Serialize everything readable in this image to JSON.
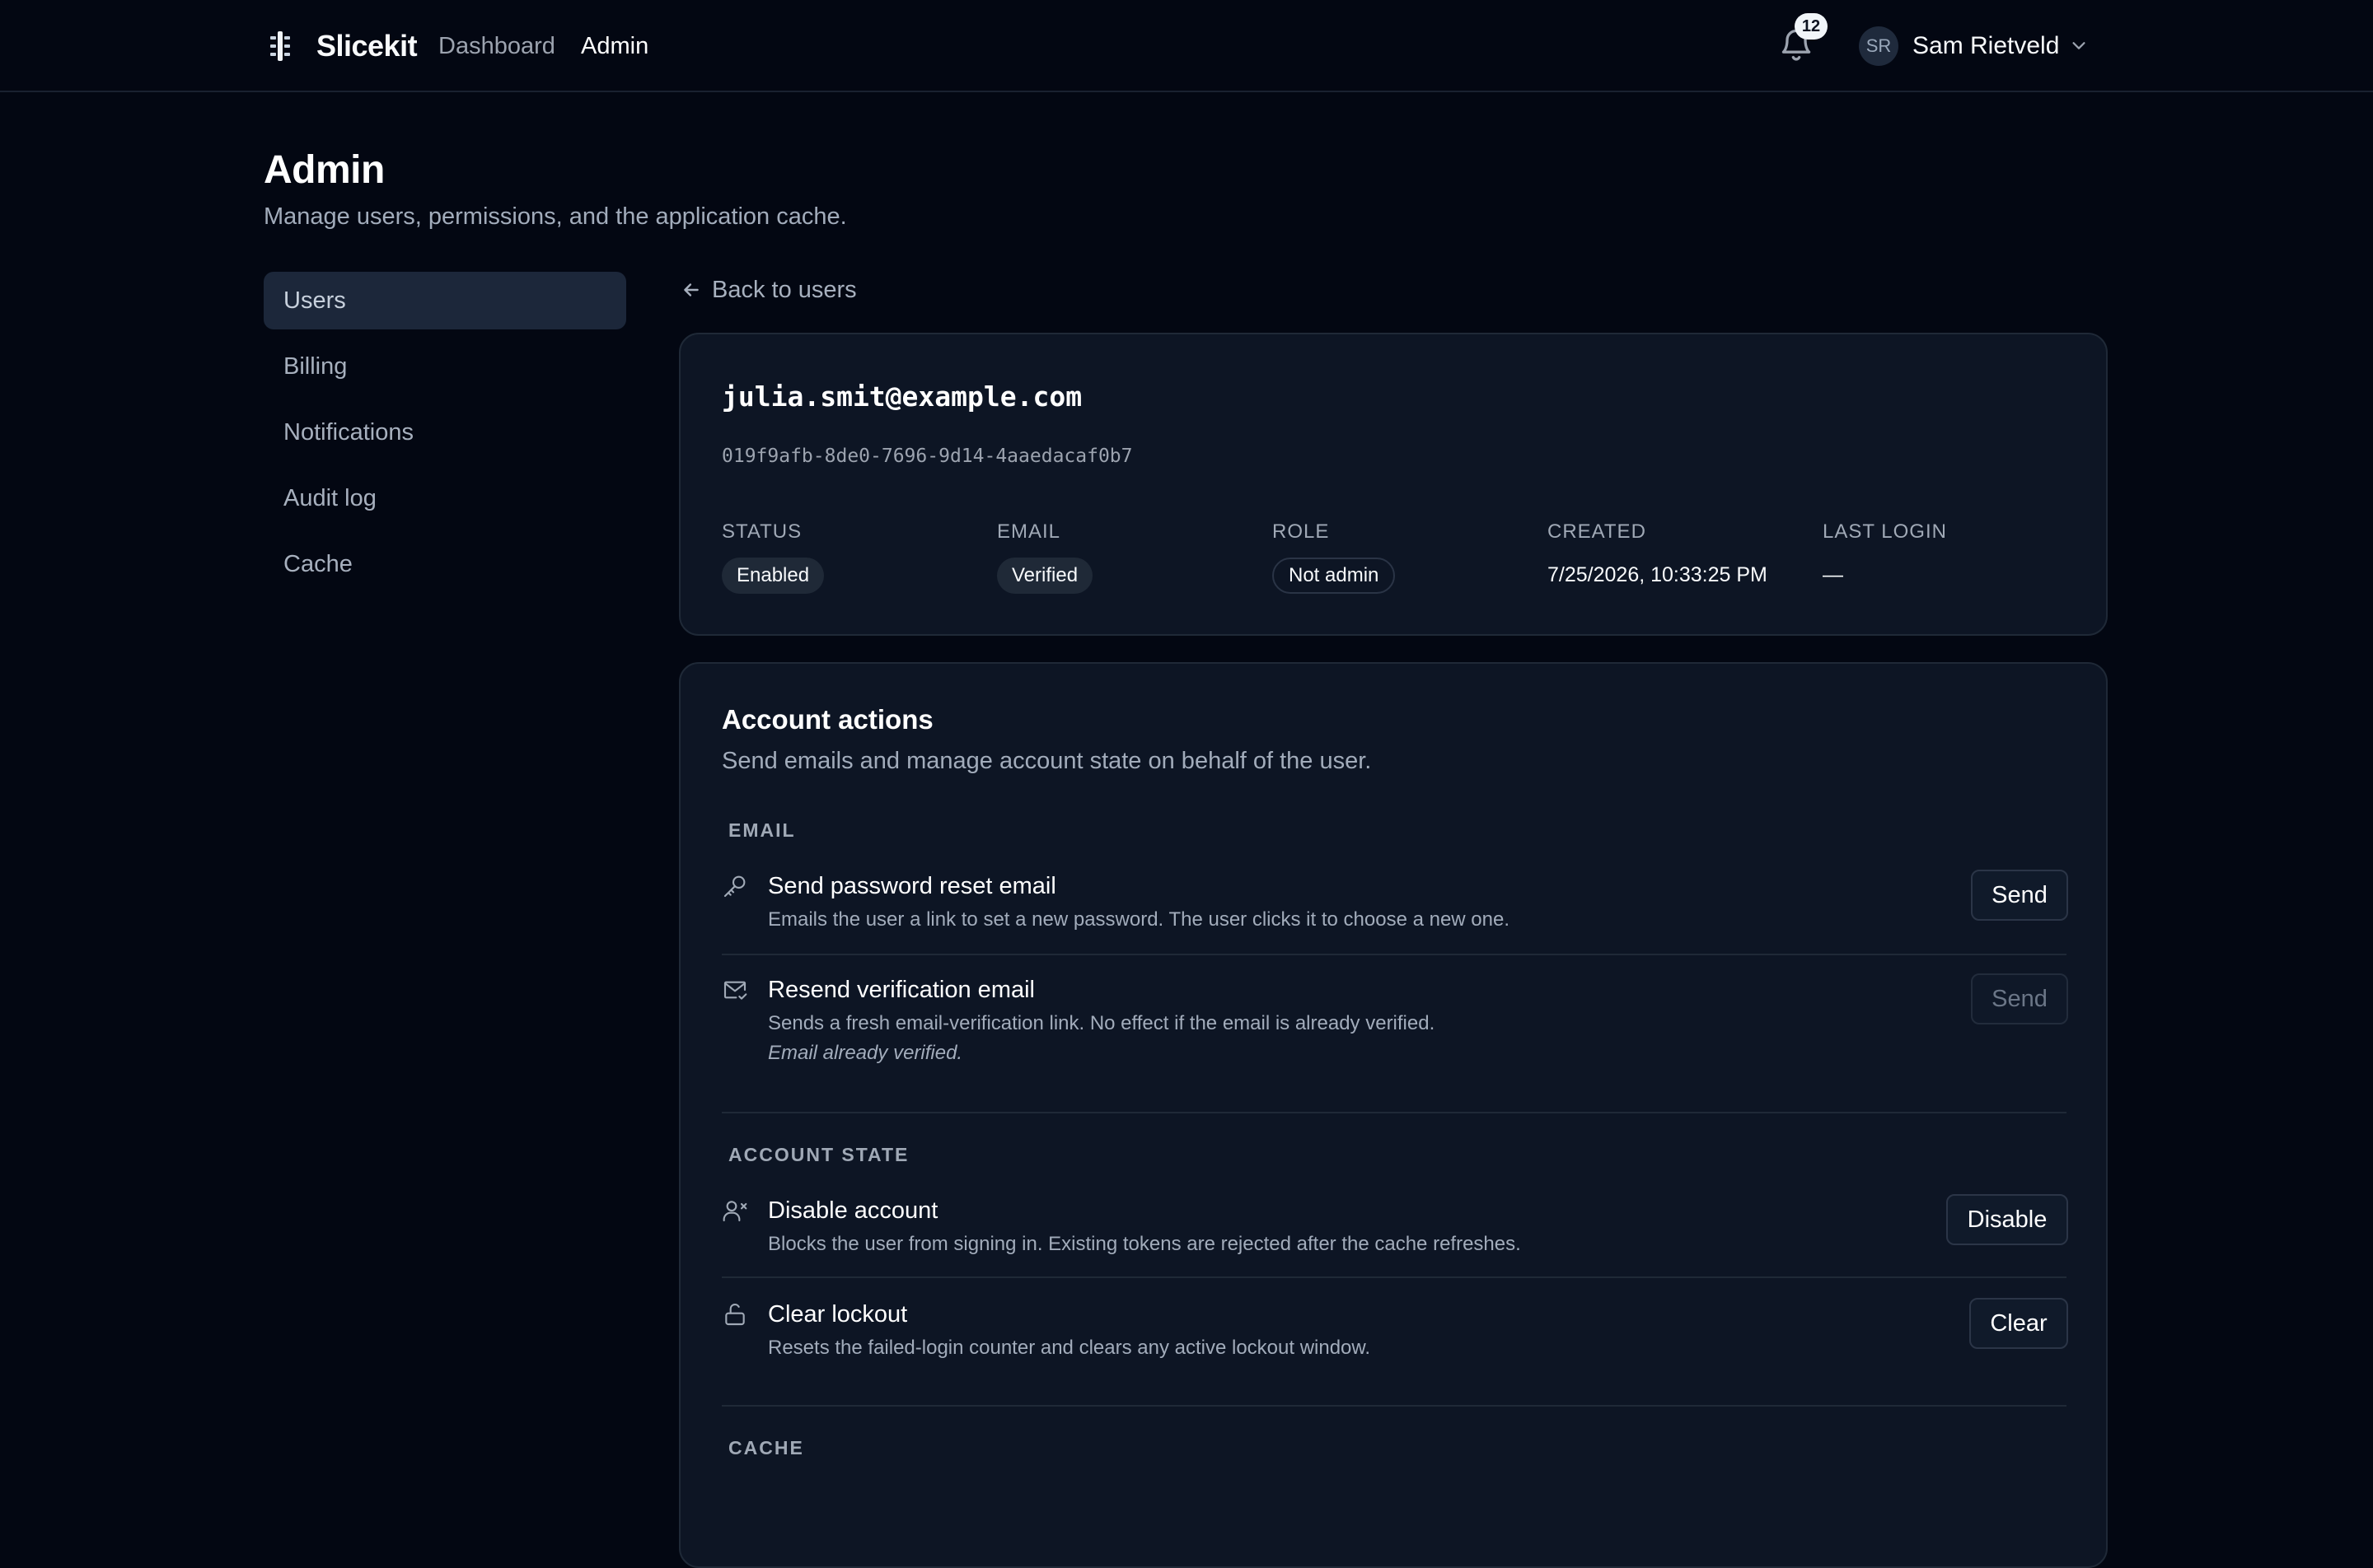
{
  "app": {
    "brand": "Slicekit",
    "nav": [
      "Dashboard",
      "Admin"
    ],
    "notifications_count": "12",
    "user_initials": "SR",
    "user_name": "Sam Rietveld"
  },
  "page": {
    "title": "Admin",
    "subtitle": "Manage users, permissions, and the application cache."
  },
  "sidebar": {
    "items": [
      {
        "label": "Users",
        "active": true
      },
      {
        "label": "Billing"
      },
      {
        "label": "Notifications"
      },
      {
        "label": "Audit log"
      },
      {
        "label": "Cache"
      }
    ]
  },
  "back_link": "Back to users",
  "user": {
    "email": "julia.smit@example.com",
    "id": "019f9afb-8de0-7696-9d14-4aaedacaf0b7",
    "meta": [
      {
        "label": "STATUS",
        "value": "Enabled"
      },
      {
        "label": "EMAIL",
        "value": "Verified"
      },
      {
        "label": "ROLE",
        "value": "Not admin"
      },
      {
        "label": "CREATED",
        "value": "7/25/2026, 10:33:25 PM"
      },
      {
        "label": "LAST LOGIN",
        "value": "—"
      }
    ]
  },
  "actions": {
    "title": "Account actions",
    "subtitle": "Send emails and manage account state on behalf of the user.",
    "groups": [
      {
        "label": "EMAIL",
        "items": [
          {
            "icon": "key-icon",
            "title": "Send password reset email",
            "desc": "Emails the user a link to set a new password. The user clicks it to choose a new one.",
            "button": "Send",
            "disabled": false
          },
          {
            "icon": "mail-check-icon",
            "title": "Resend verification email",
            "desc": "Sends a fresh email-verification link. No effect if the email is already verified.",
            "note": "Email already verified.",
            "button": "Send",
            "disabled": true
          }
        ]
      },
      {
        "label": "ACCOUNT STATE",
        "items": [
          {
            "icon": "user-x-icon",
            "title": "Disable account",
            "desc": "Blocks the user from signing in. Existing tokens are rejected after the cache refreshes.",
            "button": "Disable",
            "disabled": false
          },
          {
            "icon": "unlock-icon",
            "title": "Clear lockout",
            "desc": "Resets the failed-login counter and clears any active lockout window.",
            "button": "Clear",
            "disabled": false
          }
        ]
      },
      {
        "label": "CACHE",
        "items": []
      }
    ]
  }
}
